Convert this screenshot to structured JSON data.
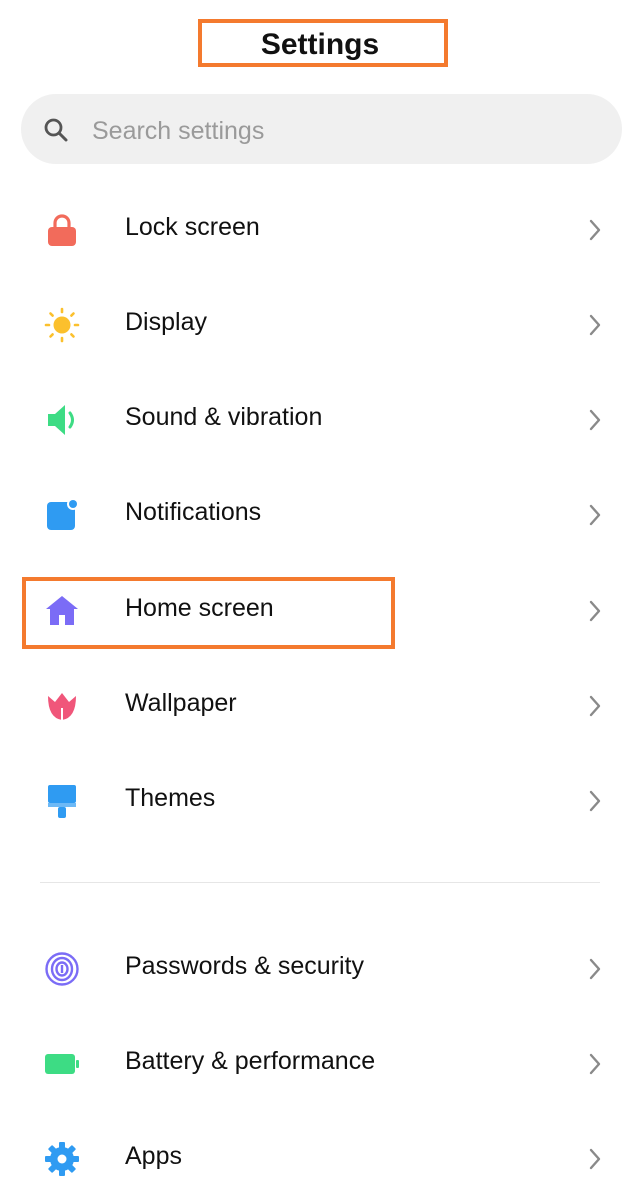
{
  "header": {
    "title": "Settings"
  },
  "search": {
    "placeholder": "Search settings",
    "value": ""
  },
  "groups": [
    {
      "items": [
        {
          "label": "Lock screen",
          "icon": "lock-icon",
          "color": "#f26b5b"
        },
        {
          "label": "Display",
          "icon": "sun-icon",
          "color": "#fbc02d"
        },
        {
          "label": "Sound & vibration",
          "icon": "speaker-icon",
          "color": "#3ddc84"
        },
        {
          "label": "Notifications",
          "icon": "notification-icon",
          "color": "#2f9bf2"
        },
        {
          "label": "Home screen",
          "icon": "home-icon",
          "color": "#7b6cf6",
          "highlighted": true
        },
        {
          "label": "Wallpaper",
          "icon": "tulip-icon",
          "color": "#f0567a"
        },
        {
          "label": "Themes",
          "icon": "brush-icon",
          "color": "#2f9bf2"
        }
      ]
    },
    {
      "items": [
        {
          "label": "Passwords & security",
          "icon": "fingerprint-icon",
          "color": "#7b6cf6"
        },
        {
          "label": "Battery & performance",
          "icon": "battery-icon",
          "color": "#3ddc84"
        },
        {
          "label": "Apps",
          "icon": "gear-icon",
          "color": "#2f9bf2"
        }
      ]
    }
  ],
  "annotation_color": "#f47a2e"
}
